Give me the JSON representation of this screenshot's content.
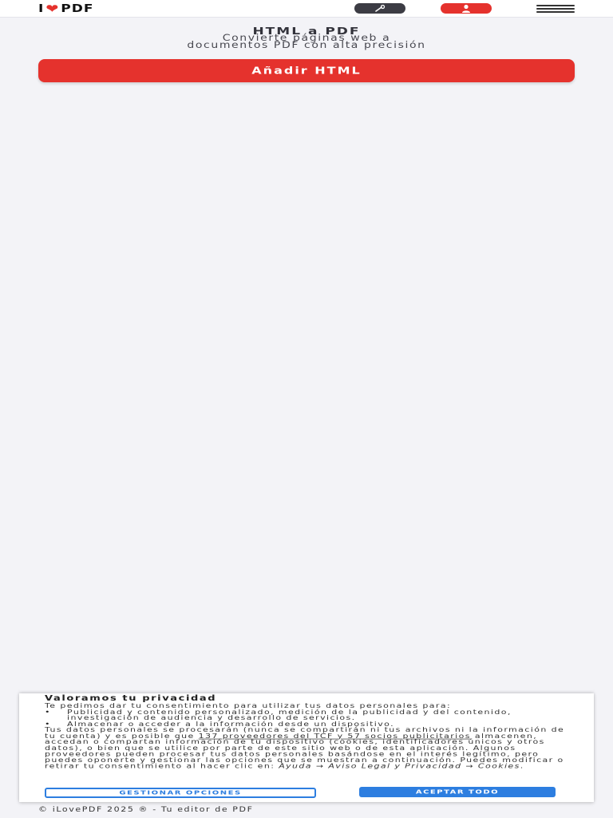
{
  "header": {
    "logo_left": "I",
    "logo_right": "PDF",
    "tools_icon": "wrench-icon",
    "user_icon": "user-icon",
    "menu_icon": "hamburger-icon",
    "brand_color": "#e5322d"
  },
  "main": {
    "title": "HTML a PDF",
    "subtitle_line1": "Convierte páginas web a",
    "subtitle_line2": "documentos PDF con alta precisión",
    "add_button_label": "Añadir HTML"
  },
  "consent": {
    "title": "Valoramos tu privacidad",
    "intro": "Te pedimos dar tu consentimiento para utilizar tus datos personales para:",
    "bullet1": "Publicidad y contenido personalizado, medición de la publicidad y del contenido, investigación de audiencia y desarrollo de servicios.",
    "bullet2": "Almacenar o acceder a la información desde un dispositivo.",
    "body_part1": "Tus datos personales se procesarán (nunca se compartirán ni tus archivos ni la información de tu cuenta) y es posible que",
    "link_partners": "137 proveedores del TCF y 57 socios publicitarios",
    "body_part2": "almacenen, accedan o compartan información de tu dispositivo (cookies, identificadores únicos y otros datos), o bien que se utilice por parte de este sitio web o de esta aplicación. Algunos proveedores pueden procesar tus datos personales basándose en el interés legítimo, pero puedes oponerte y gestionar las opciones que se muestran a continuación. Puedes modificar o retirar tu consentimiento al hacer clic en:",
    "link_help": "Ayuda → Aviso Legal y Privacidad → Cookies",
    "body_end": ".",
    "manage_label": "GESTIONAR OPCIONES",
    "accept_label": "ACEPTAR TODO",
    "accent_color": "#2d7ee0"
  },
  "footer": {
    "text": "© iLovePDF 2025 ® - Tu editor de PDF"
  }
}
